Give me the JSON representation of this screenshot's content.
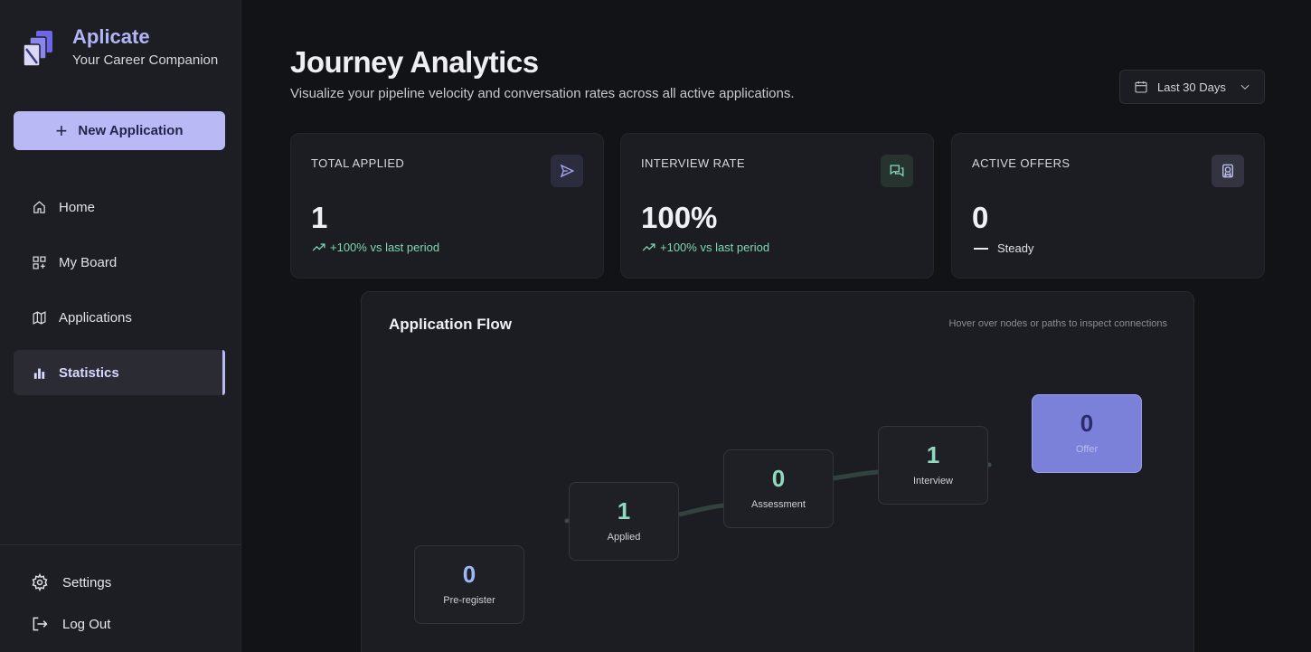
{
  "brand": {
    "name": "Aplicate",
    "tagline": "Your Career Companion",
    "logo_icon": "stacked-cards-logo"
  },
  "sidebar": {
    "new_button": {
      "label": "New Application",
      "icon": "plus-icon"
    },
    "items": [
      {
        "label": "Home",
        "icon": "home-icon",
        "active": false
      },
      {
        "label": "My Board",
        "icon": "board-icon",
        "active": false
      },
      {
        "label": "Applications",
        "icon": "map-icon",
        "active": false
      },
      {
        "label": "Statistics",
        "icon": "bar-chart-icon",
        "active": true
      }
    ],
    "footer": [
      {
        "label": "Settings",
        "icon": "gear-icon"
      },
      {
        "label": "Log Out",
        "icon": "logout-icon"
      }
    ]
  },
  "header": {
    "title": "Journey Analytics",
    "subtitle": "Visualize your pipeline velocity and conversation rates across all active applications.",
    "range": {
      "selected": "Last 30 Days",
      "icon": "calendar-icon"
    }
  },
  "stats": [
    {
      "label": "TOTAL APPLIED",
      "value": "1",
      "delta": "+100% vs last period",
      "trend": "up",
      "icon": "send-icon"
    },
    {
      "label": "INTERVIEW RATE",
      "value": "100%",
      "delta": "+100% vs last period",
      "trend": "up",
      "icon": "chat-icon"
    },
    {
      "label": "ACTIVE OFFERS",
      "value": "0",
      "delta": "Steady",
      "trend": "flat",
      "icon": "award-icon"
    }
  ],
  "flow": {
    "title": "Application Flow",
    "hint": "Hover over nodes or paths to inspect connections",
    "nodes": [
      {
        "value": "0",
        "label": "Pre-register"
      },
      {
        "value": "1",
        "label": "Applied"
      },
      {
        "value": "0",
        "label": "Assessment"
      },
      {
        "value": "1",
        "label": "Interview"
      },
      {
        "value": "0",
        "label": "Offer"
      }
    ]
  },
  "colors": {
    "accent": "#b9b9f6",
    "positive": "#7fd6b2",
    "node_value": "#9fb7f5",
    "node_value_green": "#8fd9bf",
    "offer_bg": "#7b80d8"
  }
}
